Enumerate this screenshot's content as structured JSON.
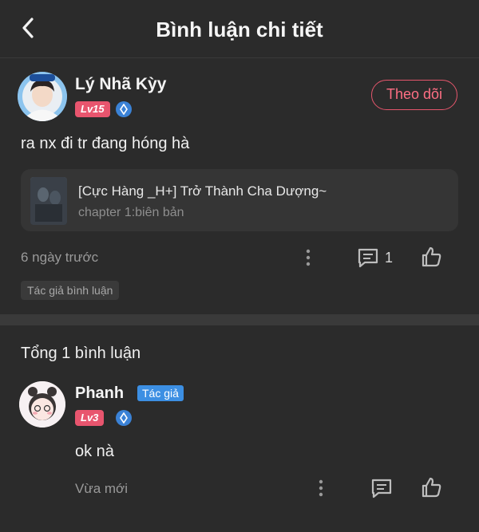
{
  "header": {
    "title": "Bình luận chi tiết"
  },
  "post": {
    "username": "Lý Nhã Kỳy",
    "level": "Lv15",
    "follow_label": "Theo dõi",
    "content": "ra nx đi tr đang hóng hà",
    "book": {
      "title": "[Cực Hàng _H+] Trở Thành Cha Dượng~",
      "chapter": "chapter 1:biên bản"
    },
    "time": "6 ngày trước",
    "reply_count": "1",
    "tag": "Tác giả bình luận"
  },
  "replies_section": {
    "title": "Tổng 1 bình luận",
    "replies": [
      {
        "username": "Phanh",
        "badge": "Tác giả",
        "level": "Lv3",
        "content": "ok nà",
        "time": "Vừa mới"
      }
    ]
  },
  "colors": {
    "background": "#2b2b2b",
    "accent": "#e8556e",
    "badge_blue": "#3c8fe3"
  }
}
